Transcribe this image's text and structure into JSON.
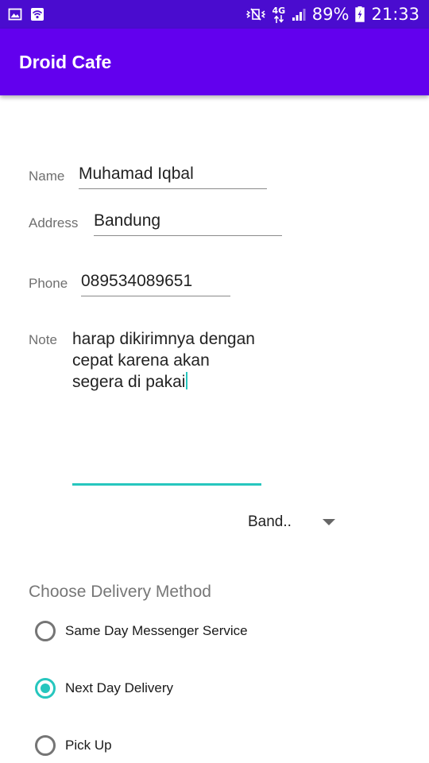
{
  "status_bar": {
    "network_type": "4G",
    "battery_level": "89%",
    "time": "21:33",
    "left_icons": [
      "image-icon",
      "wifi-box-icon"
    ],
    "right_icons": [
      "mute-vibrate-icon",
      "data-arrows-icon",
      "signal-icon",
      "battery-charging-icon"
    ]
  },
  "app_bar": {
    "title": "Droid Cafe",
    "color": "#6200ee",
    "status_color": "#4a0ccf"
  },
  "form": {
    "name": {
      "label": "Name",
      "value": "Muhamad Iqbal"
    },
    "address": {
      "label": "Address",
      "value": "Bandung"
    },
    "phone": {
      "label": "Phone",
      "value": "089534089651"
    },
    "note": {
      "label": "Note",
      "lines": [
        "harap dikirimnya dengan",
        "cepat karena akan",
        "segera di pakai"
      ]
    },
    "spinner": {
      "selected": "Band.."
    }
  },
  "delivery": {
    "title": "Choose Delivery Method",
    "accent_color": "#26c6be",
    "options": [
      {
        "label": "Same Day Messenger Service",
        "checked": false
      },
      {
        "label": "Next Day Delivery",
        "checked": true
      },
      {
        "label": "Pick Up",
        "checked": false
      }
    ]
  }
}
